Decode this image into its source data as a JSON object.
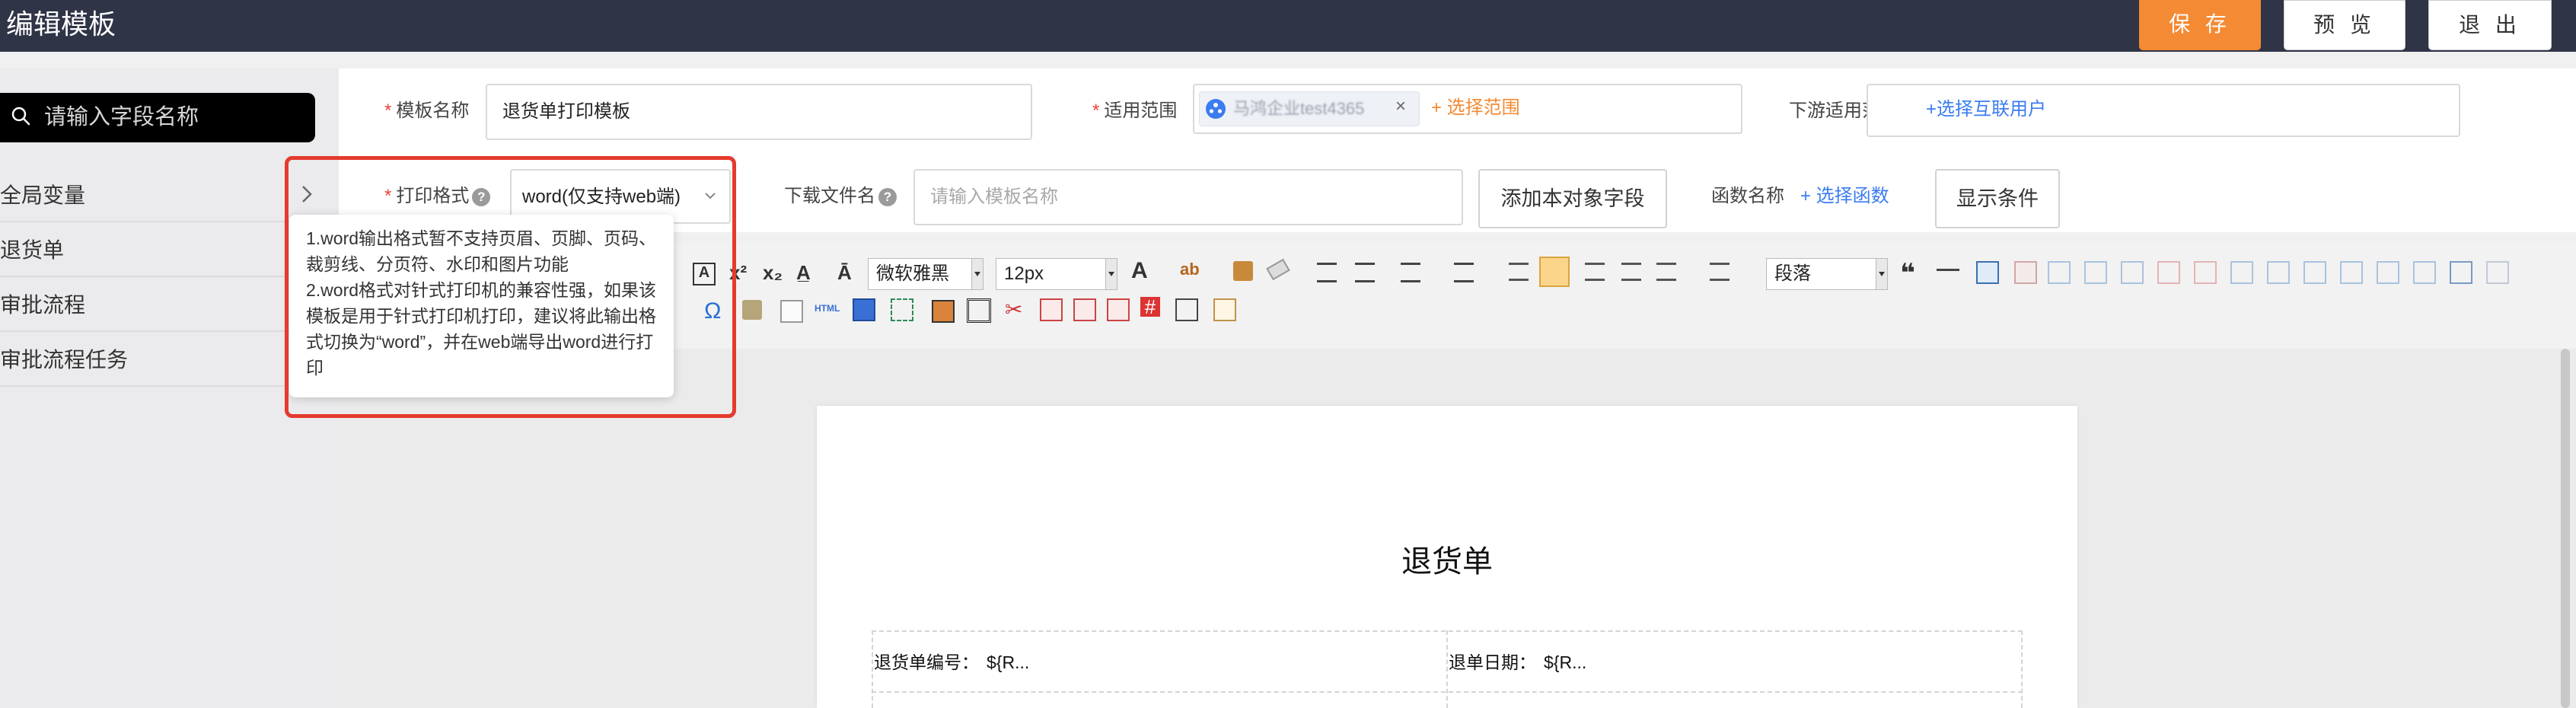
{
  "header": {
    "title": "编辑模板",
    "save_label": "保 存",
    "preview_label": "预 览",
    "exit_label": "退 出"
  },
  "sidebar": {
    "search_placeholder": "请输入字段名称",
    "items": [
      {
        "label": "全局变量"
      },
      {
        "label": "退货单"
      },
      {
        "label": "审批流程"
      },
      {
        "label": "审批流程任务"
      }
    ]
  },
  "form": {
    "template_name_label": "模板名称",
    "template_name_value": "退货单打印模板",
    "scope_label": "适用范围",
    "scope_tag": "马鸿企业test4365",
    "scope_link": "+ 选择范围",
    "downstream_label": "下游适用范围",
    "downstream_link": "+选择互联用户",
    "print_format_label": "打印格式",
    "print_format_value": "word(仅支持web端)",
    "download_label": "下载文件名",
    "download_placeholder": "请输入模板名称",
    "add_field_button": "添加本对象字段",
    "function_label": "函数名称",
    "function_link": "+ 选择函数",
    "show_condition_button": "显示条件"
  },
  "tooltip": {
    "line1": "1.word输出格式暂不支持页眉、页脚、页码、裁剪线、分页符、水印和图片功能",
    "line2": "2.word格式对针式打印机的兼容性强，如果该模板是用于针式打印机打印，建议将此输出格式切换为“word”，并在web端导出word进行打印"
  },
  "toolbar": {
    "font_family": "微软雅黑",
    "font_size": "12px",
    "paragraph": "段落"
  },
  "document": {
    "title": "退货单",
    "row1_left_label": "退货单编号：",
    "row1_left_value": "${R...",
    "row1_right_label": "退单日期：",
    "row1_right_value": "${R..."
  },
  "colors": {
    "header_bg": "#2f3447",
    "accent_orange": "#f48a33",
    "link_blue": "#3b7cf0",
    "highlight_red": "#e53a2d"
  }
}
